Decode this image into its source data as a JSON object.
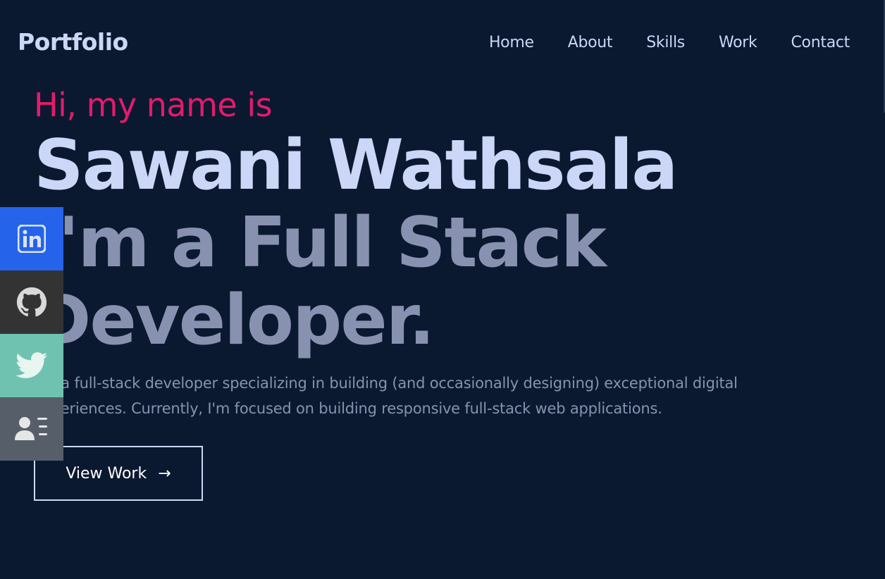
{
  "header": {
    "logo": "Portfolio",
    "nav": [
      "Home",
      "About",
      "Skills",
      "Work",
      "Contact"
    ]
  },
  "hero": {
    "greeting": "Hi, my name is",
    "name": "Sawani Wathsala",
    "role": "I'm a Full Stack Developer.",
    "intro": "I'm a full-stack developer specializing in building (and occasionally designing) exceptional digital experiences. Currently, I'm focused on building responsive full-stack web applications.",
    "cta_label": "View Work",
    "cta_arrow": "→"
  },
  "social": [
    {
      "name": "linkedin-icon",
      "color": "#2563eb"
    },
    {
      "name": "github-icon",
      "color": "#333333"
    },
    {
      "name": "twitter-icon",
      "color": "#6fc2b0"
    },
    {
      "name": "resume-icon",
      "color": "#565f69"
    }
  ],
  "colors": {
    "background": "#0a192f",
    "accent": "#e31b6d",
    "heading": "#ccd6f6",
    "muted": "#8892b0"
  }
}
